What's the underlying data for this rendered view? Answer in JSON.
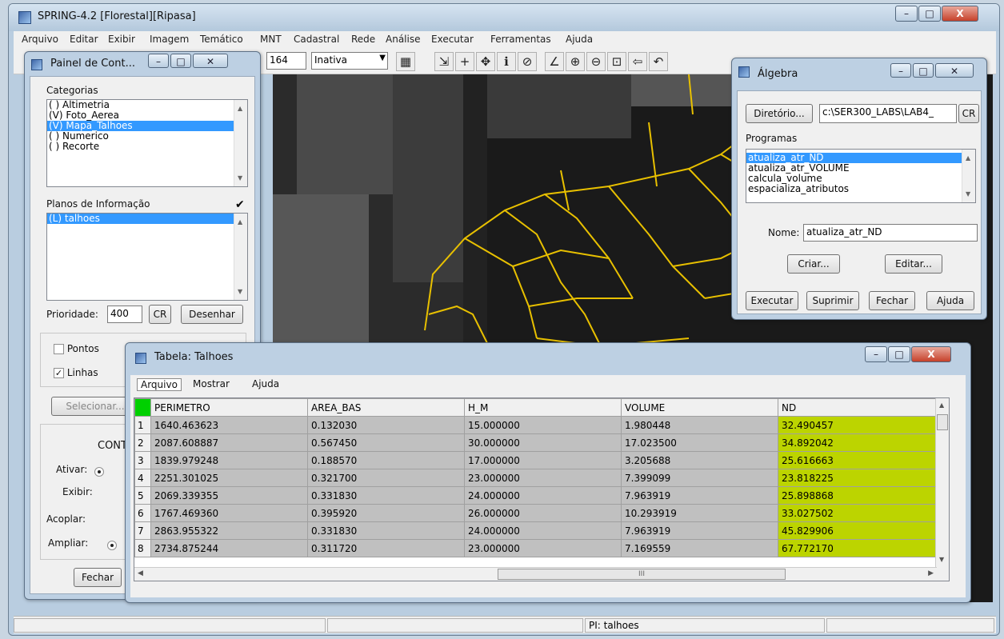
{
  "main_window": {
    "title": "SPRING-4.2 [Florestal][Ripasa]",
    "controls": {
      "minimize": "–",
      "maximize": "□",
      "close": "X"
    }
  },
  "menubar": [
    "Arquivo",
    "Editar",
    "Exibir",
    "Imagem",
    "Temático",
    "MNT",
    "Cadastral",
    "Rede",
    "Análise",
    "Executar",
    "Ferramentas",
    "Ajuda"
  ],
  "toolbar": {
    "scale_value": "164",
    "mode_select": "Inativa"
  },
  "statusbar": {
    "pi": "PI: talhoes"
  },
  "painel": {
    "title": "Painel de Cont...",
    "categorias_label": "Categorias",
    "categorias": [
      "( ) Altimetria",
      "(V) Foto_Aerea",
      "(V) Mapa_Talhoes",
      "( ) Numerico",
      "( ) Recorte"
    ],
    "selected_categoria": 2,
    "planos_label": "Planos de Informação",
    "planos": [
      "(L) talhoes"
    ],
    "prioridade_label": "Prioridade:",
    "prioridade_value": "400",
    "cr_button": "CR",
    "desenhar_button": "Desenhar",
    "pontos_label": "Pontos",
    "linhas_label": "Linhas",
    "selecionar_button": "Selecionar...",
    "contr_label": "CONTR",
    "ativar_label": "Ativar:",
    "exibir_label": "Exibir:",
    "acoplar_label": "Acoplar:",
    "ampliar_label": "Ampliar:",
    "fechar_button": "Fechar"
  },
  "algebra": {
    "title": "Álgebra",
    "diretorio_button": "Diretório...",
    "diretorio_value": "c:\\SER300_LABS\\LAB4_",
    "cr_button": "CR",
    "programas_label": "Programas",
    "programas": [
      "atualiza_atr_ND",
      "atualiza_atr_VOLUME",
      "calcula_volume",
      "espacializa_atributos"
    ],
    "selected_programa": 0,
    "nome_label": "Nome:",
    "nome_value": "atualiza_atr_ND",
    "criar_button": "Criar...",
    "editar_button": "Editar...",
    "executar_button": "Executar",
    "suprimir_button": "Suprimir",
    "fechar_button": "Fechar",
    "ajuda_button": "Ajuda"
  },
  "tabela": {
    "title": "Tabela: Talhoes",
    "menu": [
      "Arquivo",
      "Mostrar",
      "Ajuda"
    ],
    "columns": [
      "PERIMETRO",
      "AREA_BAS",
      "H_M",
      "VOLUME",
      "ND"
    ],
    "rows": [
      {
        "id": "1",
        "cells": [
          "1640.463623",
          "0.132030",
          "15.000000",
          "1.980448",
          "32.490457"
        ]
      },
      {
        "id": "2",
        "cells": [
          "2087.608887",
          "0.567450",
          "30.000000",
          "17.023500",
          "34.892042"
        ]
      },
      {
        "id": "3",
        "cells": [
          "1839.979248",
          "0.188570",
          "17.000000",
          "3.205688",
          "25.616663"
        ]
      },
      {
        "id": "4",
        "cells": [
          "2251.301025",
          "0.321700",
          "23.000000",
          "7.399099",
          "23.818225"
        ]
      },
      {
        "id": "5",
        "cells": [
          "2069.339355",
          "0.331830",
          "24.000000",
          "7.963919",
          "25.898868"
        ]
      },
      {
        "id": "6",
        "cells": [
          "1767.469360",
          "0.395920",
          "26.000000",
          "10.293919",
          "33.027502"
        ]
      },
      {
        "id": "7",
        "cells": [
          "2863.955322",
          "0.331830",
          "24.000000",
          "7.963919",
          "45.829906"
        ]
      },
      {
        "id": "8",
        "cells": [
          "2734.875244",
          "0.311720",
          "23.000000",
          "7.169559",
          "67.772170"
        ]
      }
    ],
    "hscroll_glyph": "III"
  },
  "colors": {
    "selection": "#3399ff",
    "nd_highlight": "#bcd400",
    "map_lines": "#e8c000",
    "grid_corner": "#00d000"
  }
}
